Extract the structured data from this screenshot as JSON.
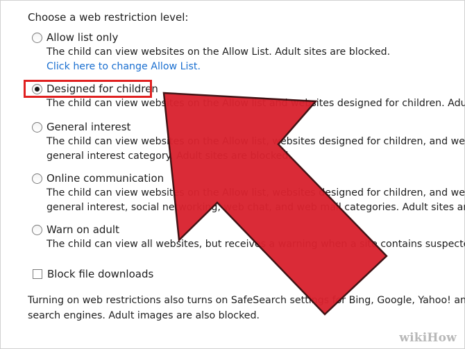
{
  "heading": "Choose a web restriction level:",
  "options": [
    {
      "label": "Allow list only",
      "checked": false,
      "desc": [
        "The child can view websites on the Allow List. Adult sites are blocked."
      ],
      "link": "Click here to change Allow List."
    },
    {
      "label": "Designed for children",
      "checked": true,
      "desc": [
        "The child can view websites on the Allow list and websites designed for children. Adult"
      ]
    },
    {
      "label": "General interest",
      "checked": false,
      "desc": [
        "The child can view websites on the Allow list, websites designed for children, and websi",
        "general interest category. Adult sites are blocked."
      ]
    },
    {
      "label": "Online communication",
      "checked": false,
      "desc": [
        "The child can view websites on the Allow list, websites designed for children, and websi",
        "general interest, social networking, web chat, and web mail categories. Adult sites are b"
      ]
    },
    {
      "label": "Warn on adult",
      "checked": false,
      "desc": [
        "The child can view all websites, but receives a warning when a site contains suspected"
      ]
    }
  ],
  "block_downloads": {
    "label": "Block file downloads",
    "checked": false
  },
  "footer": [
    "Turning on web restrictions also turns on SafeSearch settings for Bing, Google, Yahoo! and",
    "search engines. Adult images are also blocked."
  ],
  "watermark": "wikiHow",
  "colors": {
    "highlight_border": "#e02020",
    "arrow_fill": "#d9232f",
    "link": "#1a6fd0"
  }
}
